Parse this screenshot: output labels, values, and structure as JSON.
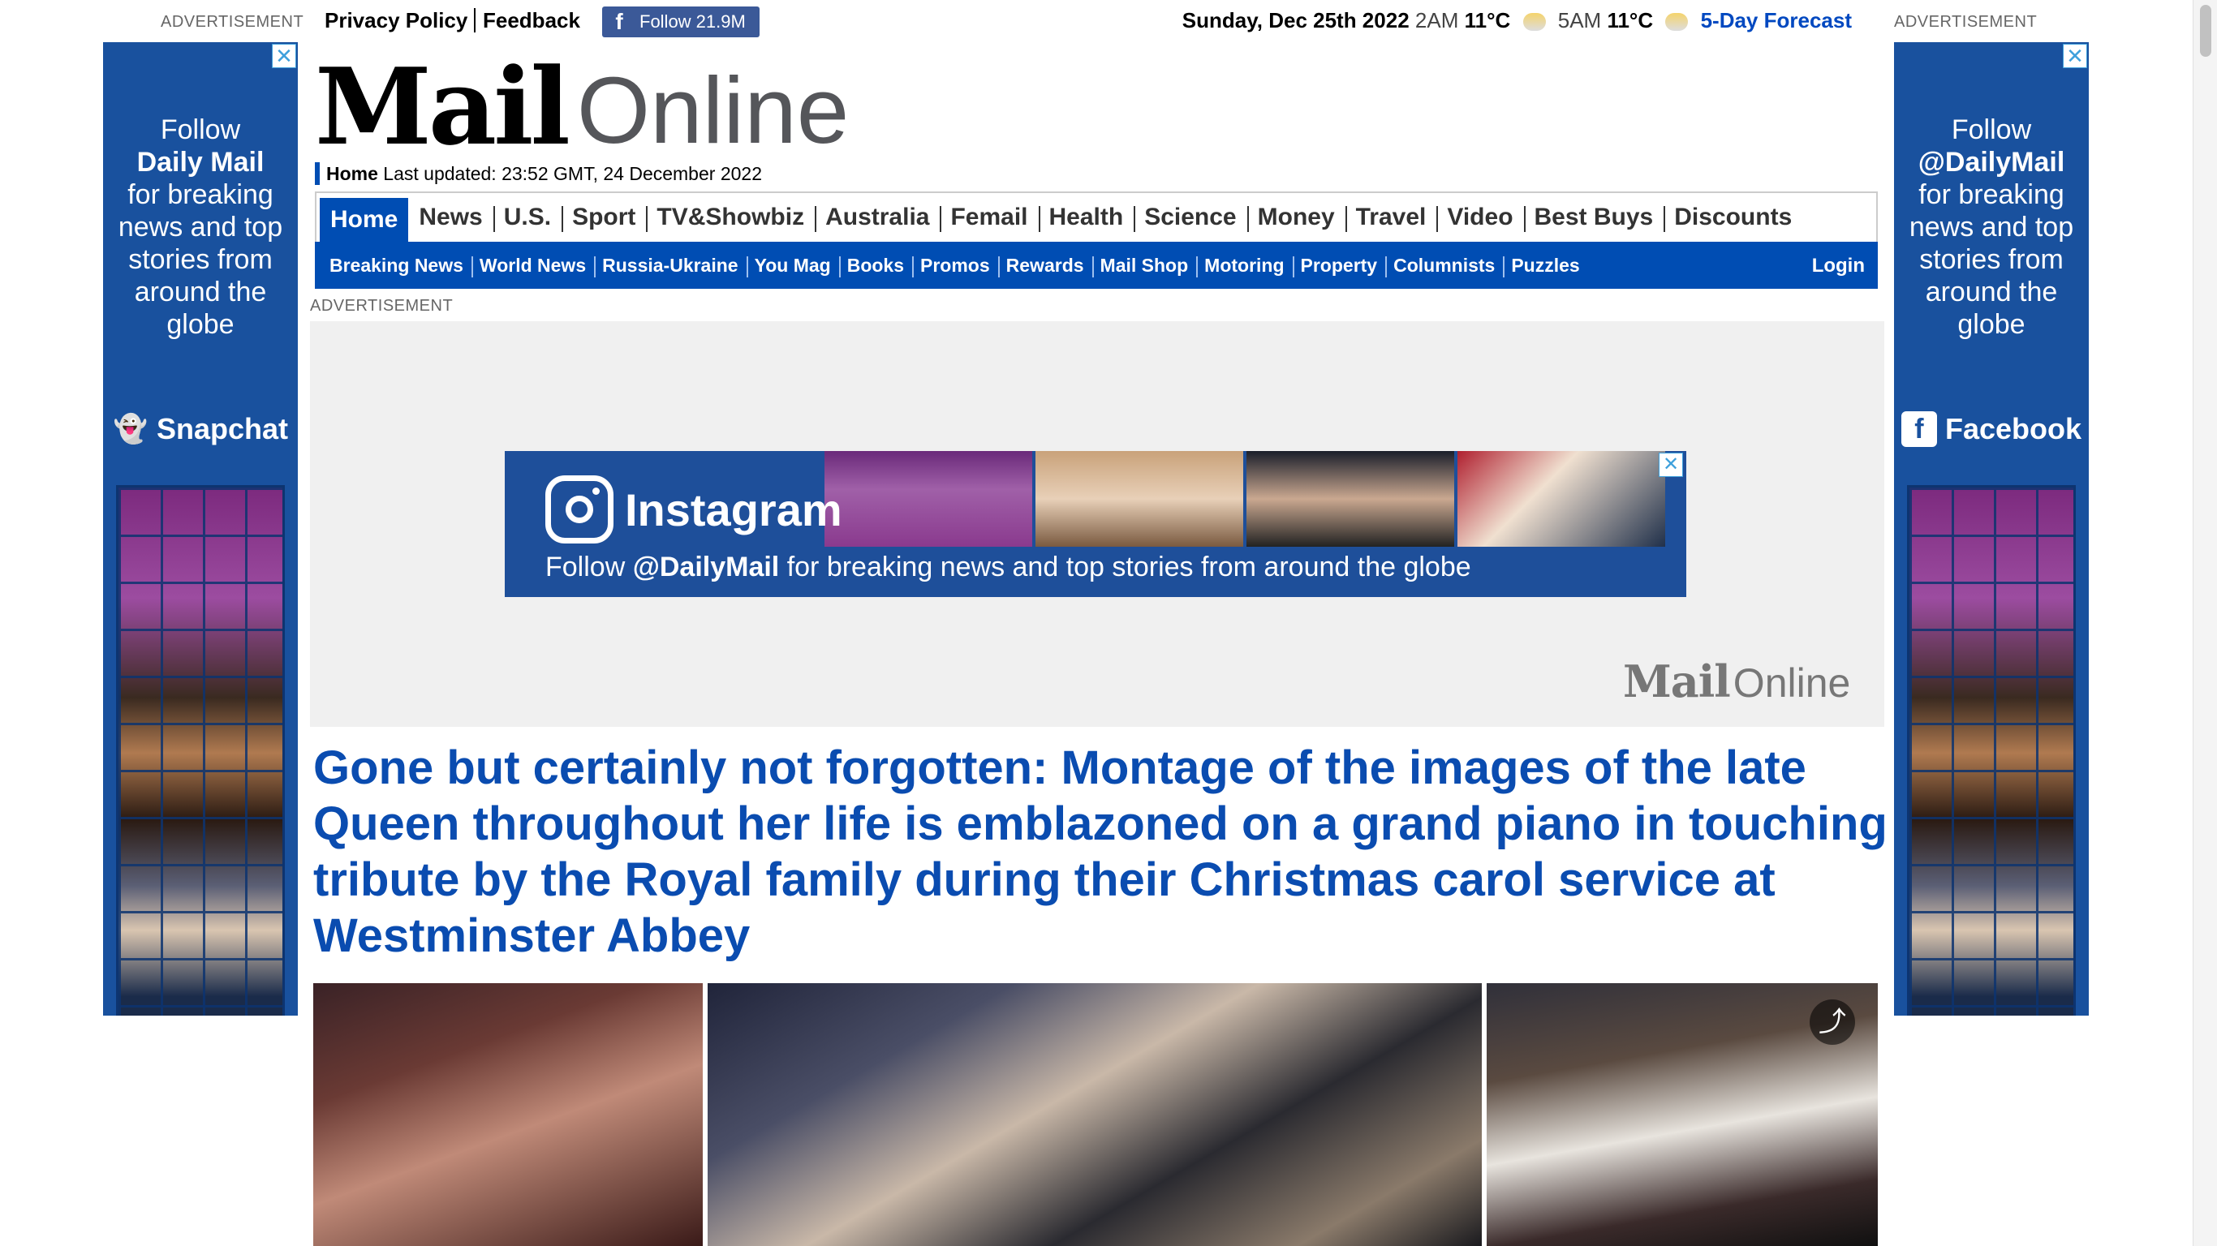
{
  "top_bar": {
    "ad_label_left": "ADVERTISEMENT",
    "ad_label_right": "ADVERTISEMENT",
    "privacy_policy": "Privacy Policy",
    "feedback": "Feedback",
    "facebook_follow": "Follow 21.9M",
    "date": "Sunday, Dec 25th 2022",
    "time1": "2AM",
    "temp1": "11°C",
    "time2": "5AM",
    "temp2": "11°C",
    "forecast": "5-Day Forecast"
  },
  "left_ad": {
    "line1": "Follow",
    "line2": "Daily Mail",
    "line3": "for breaking",
    "line4": "news and top",
    "line5": "stories from",
    "line6": "around the",
    "line7": "globe",
    "brand": "Snapchat",
    "close": "✕"
  },
  "right_ad": {
    "line1": "Follow",
    "line2": "@DailyMail",
    "line3": "for breaking",
    "line4": "news and top",
    "line5": "stories from",
    "line6": "around the",
    "line7": "globe",
    "brand": "Facebook",
    "close": "✕"
  },
  "logo": {
    "mail": "Mail",
    "online": "Online"
  },
  "updated": {
    "home": "Home",
    "text": "Last updated: 23:52 GMT, 24 December 2022"
  },
  "nav_primary": [
    "Home",
    "News",
    "U.S.",
    "Sport",
    "TV&Showbiz",
    "Australia",
    "Femail",
    "Health",
    "Science",
    "Money",
    "Travel",
    "Video",
    "Best Buys",
    "Discounts"
  ],
  "nav_secondary": [
    "Breaking News",
    "World News",
    "Russia-Ukraine",
    "You Mag",
    "Books",
    "Promos",
    "Rewards",
    "Mail Shop",
    "Motoring",
    "Property",
    "Columnists",
    "Puzzles"
  ],
  "login": "Login",
  "content_ad": {
    "label": "ADVERTISEMENT",
    "brand": "Instagram",
    "tag_prefix": "Follow",
    "tag_handle": "@DailyMail",
    "tag_suffix": "for breaking news and top stories from around the globe",
    "close": "✕",
    "footer_mail": "Mail",
    "footer_online": "Online"
  },
  "headline": "Gone but certainly not forgotten: Montage of the images of the late Queen throughout her life is emblazoned on a grand piano in touching tribute by the Royal family during their Christmas carol service at Westminster Abbey",
  "colors": {
    "brand_blue": "#004db3",
    "headline_blue": "#0a4cb0",
    "facebook": "#3b5998"
  }
}
